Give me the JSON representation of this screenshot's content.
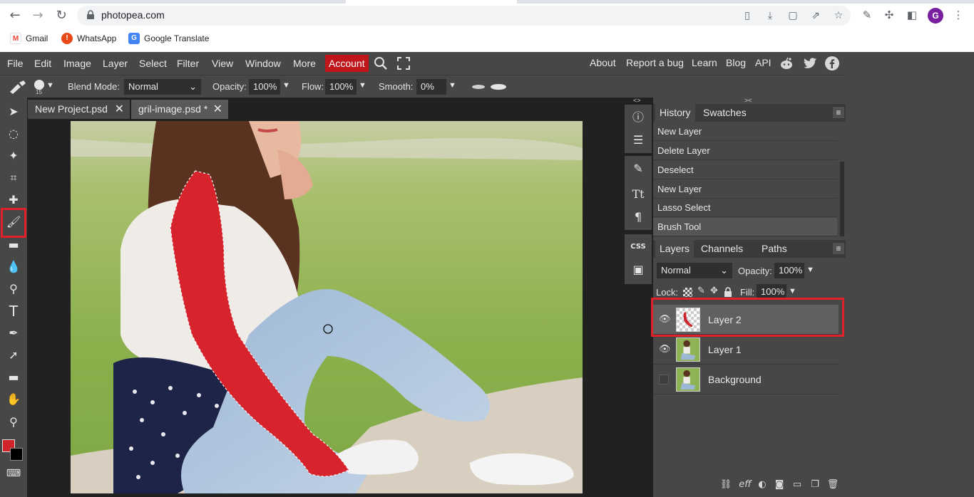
{
  "browser": {
    "url": "photopea.com",
    "bookmarks": [
      "Gmail",
      "WhatsApp",
      "Google Translate"
    ],
    "profile_initial": "G"
  },
  "menu": {
    "items": [
      "File",
      "Edit",
      "Image",
      "Layer",
      "Select",
      "Filter",
      "View",
      "Window",
      "More"
    ],
    "account": "Account",
    "right": [
      "About",
      "Report a bug",
      "Learn",
      "Blog",
      "API"
    ]
  },
  "options": {
    "brush_size": "15",
    "blend_label": "Blend Mode:",
    "blend_value": "Normal",
    "opacity_label": "Opacity:",
    "opacity_value": "100%",
    "flow_label": "Flow:",
    "flow_value": "100%",
    "smooth_label": "Smooth:",
    "smooth_value": "0%"
  },
  "doc_tabs": [
    {
      "label": "New Project.psd",
      "close": "✕"
    },
    {
      "label": "gril-image.psd *",
      "close": "✕"
    }
  ],
  "history": {
    "tabs": [
      "History",
      "Swatches"
    ],
    "items": [
      "New Layer",
      "Delete Layer",
      "Deselect",
      "New Layer",
      "Lasso Select",
      "Brush Tool"
    ]
  },
  "layers": {
    "tabs": [
      "Layers",
      "Channels",
      "Paths"
    ],
    "blend_value": "Normal",
    "opacity_label": "Opacity:",
    "opacity_value": "100%",
    "lock_label": "Lock:",
    "fill_label": "Fill:",
    "fill_value": "100%",
    "rows": [
      {
        "name": "Layer 2",
        "visible": true,
        "selected": true
      },
      {
        "name": "Layer 1",
        "visible": true,
        "selected": false
      },
      {
        "name": "Background",
        "visible": false,
        "selected": false
      }
    ],
    "bottom_icons": [
      "link-icon",
      "effects-icon",
      "adjustment-icon",
      "mask-icon",
      "folder-icon",
      "new-layer-icon",
      "trash-icon"
    ],
    "effects_label": "eff"
  },
  "mini_panel": {
    "css_label": "CSS",
    "icons": [
      "info-icon",
      "sliders-icon",
      "brush-settings-icon",
      "character-icon",
      "paragraph-icon",
      "css-icon",
      "image-icon"
    ]
  },
  "colors": {
    "foreground": "#d1232a",
    "background": "#000000",
    "accent": "#c0151a",
    "highlight": "#e0212a"
  }
}
